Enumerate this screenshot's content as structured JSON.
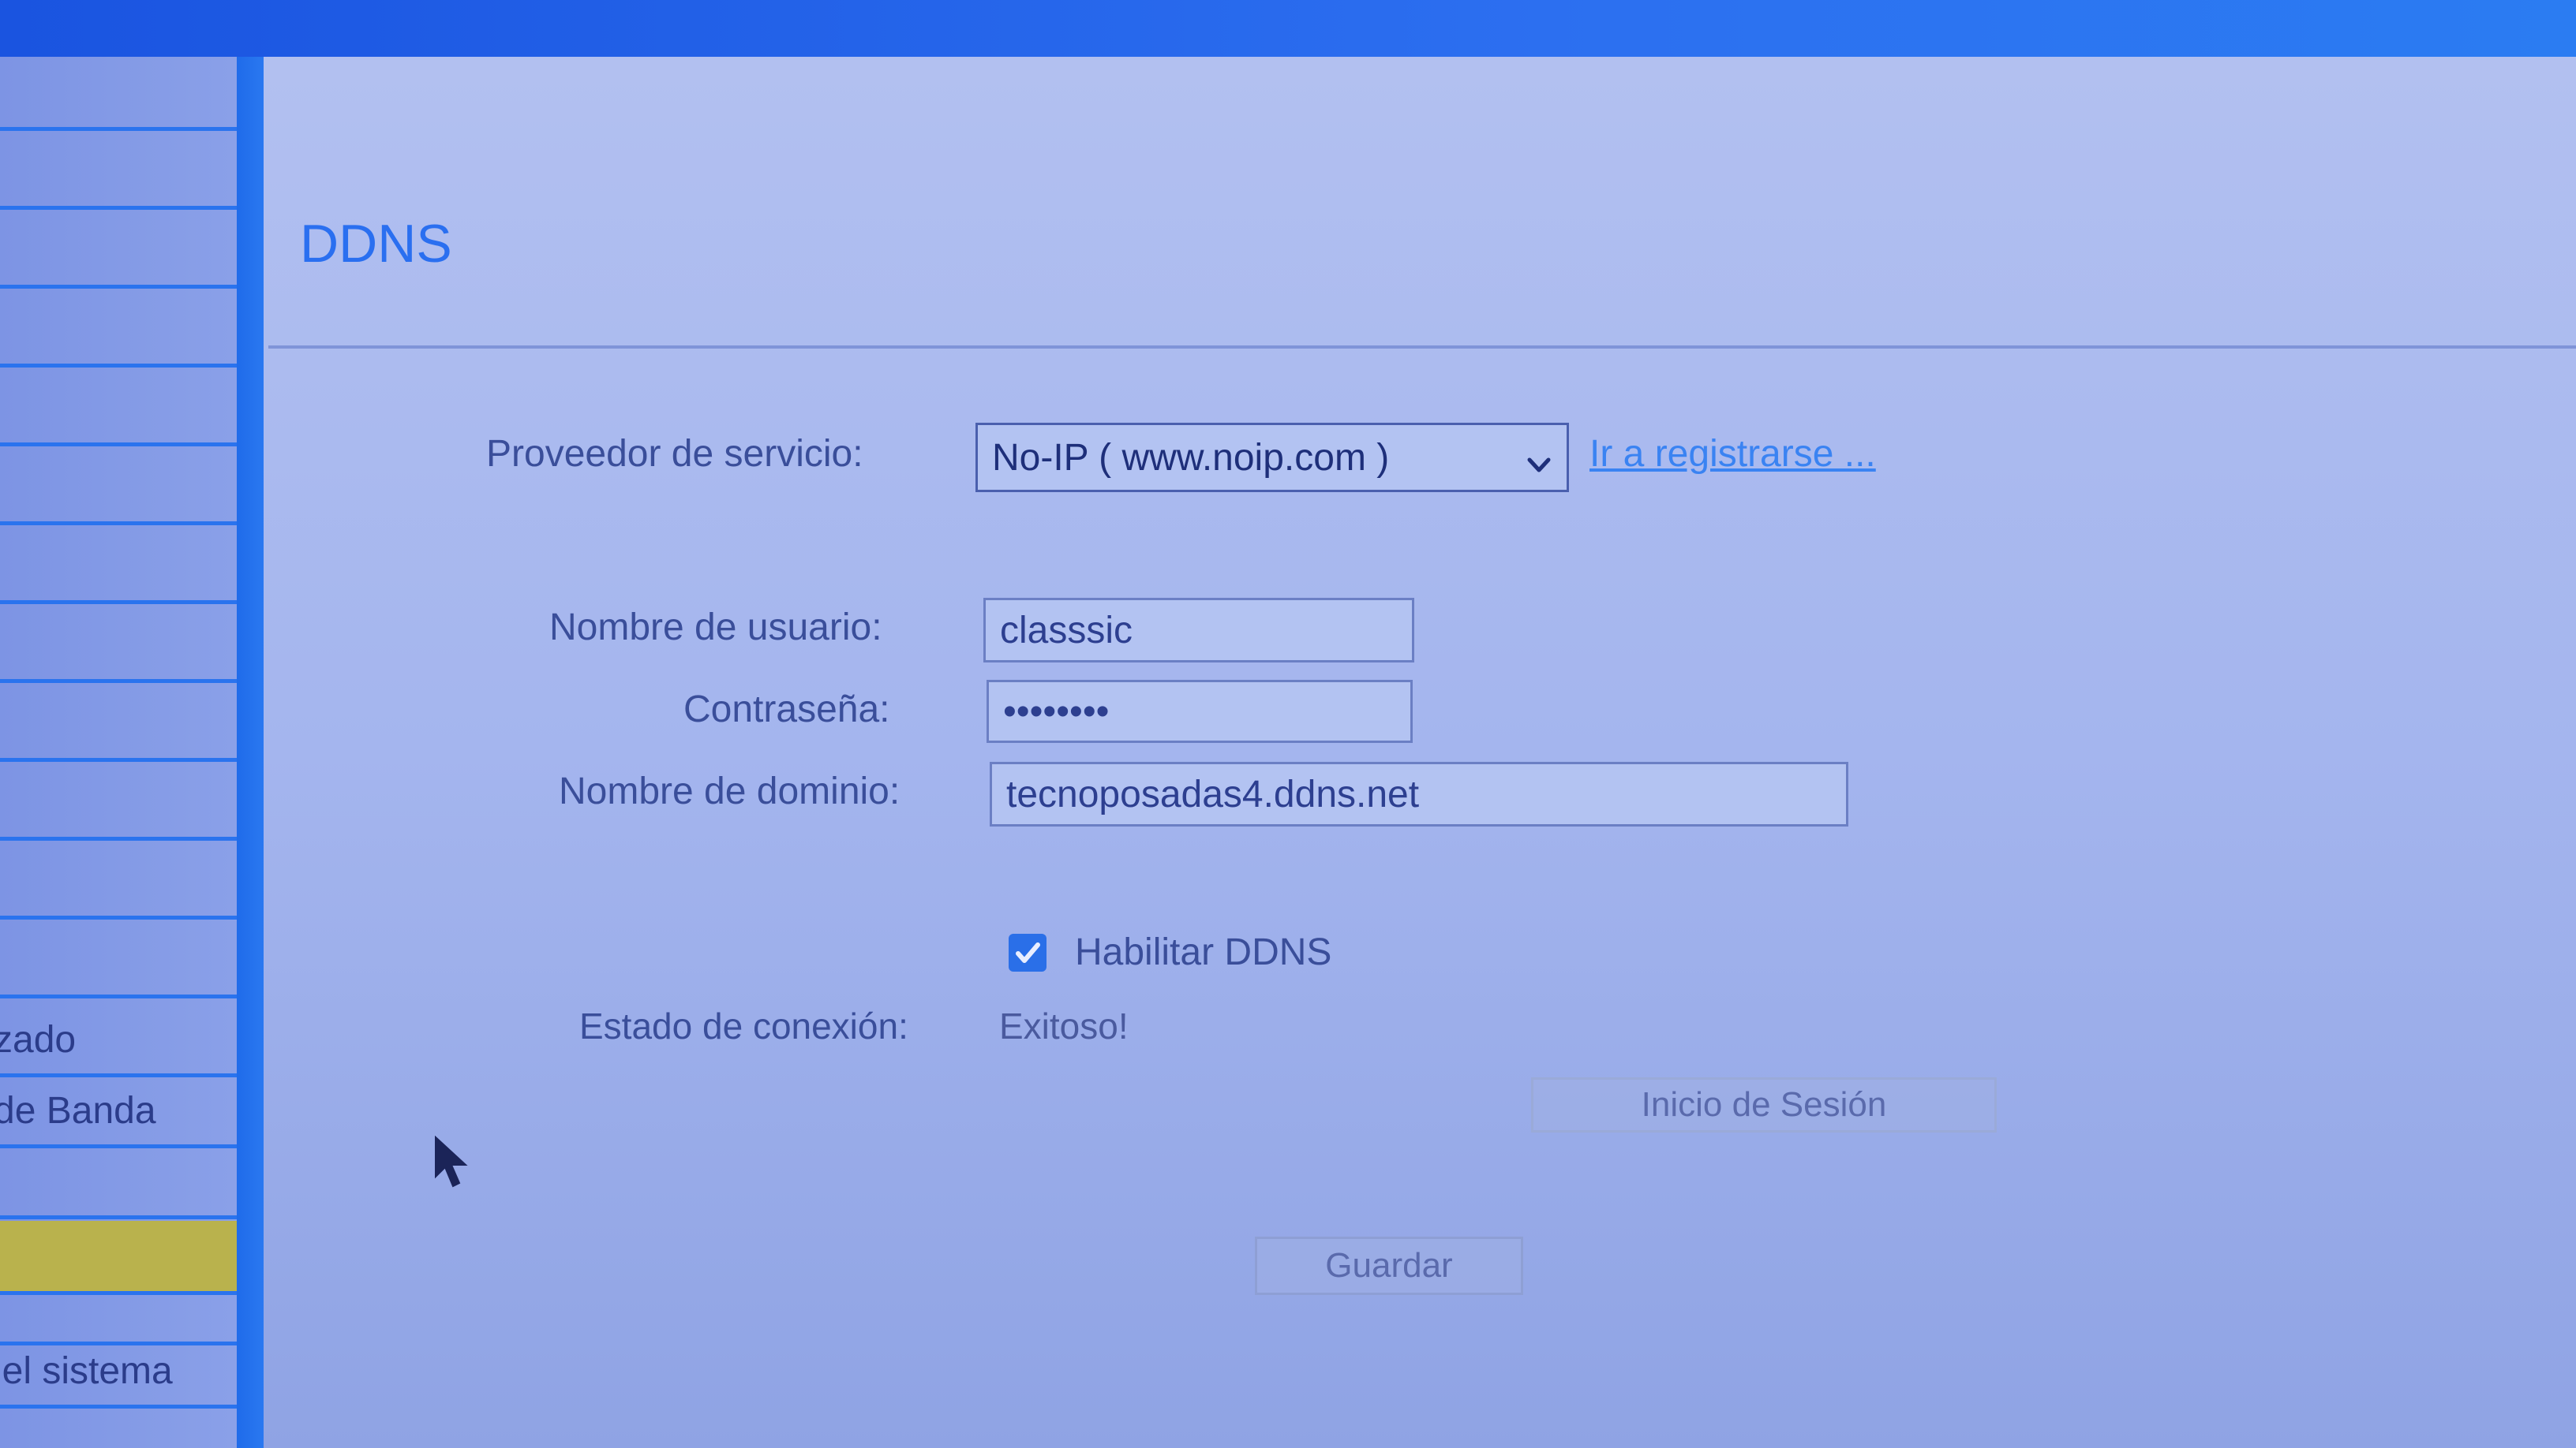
{
  "page": {
    "title": "DDNS"
  },
  "sidebar": {
    "items": [
      {
        "label": ""
      },
      {
        "label": ""
      },
      {
        "label": ""
      },
      {
        "label": ""
      },
      {
        "label": ""
      },
      {
        "label": ""
      },
      {
        "label": ""
      },
      {
        "label": ""
      },
      {
        "label": ""
      },
      {
        "label": ""
      },
      {
        "label": ""
      },
      {
        "label": ""
      },
      {
        "label": "zado"
      },
      {
        "label": "de Banda"
      },
      {
        "label": ""
      },
      {
        "label": "",
        "active": true
      },
      {
        "label": ""
      },
      {
        "label": "lel sistema"
      }
    ]
  },
  "form": {
    "provider_label": "Proveedor de servicio:",
    "provider_value": "No-IP ( www.noip.com )",
    "register_link": "Ir a registrarse ...",
    "username_label": "Nombre de usuario:",
    "username_value": "classsic",
    "password_label": "Contraseña:",
    "password_value": "••••••••",
    "domain_label": "Nombre de dominio:",
    "domain_value": "tecnoposadas4.ddns.net",
    "enable_label": "Habilitar DDNS",
    "enable_checked": true,
    "status_label": "Estado de conexión:",
    "status_value": "Exitoso!",
    "login_button": "Inicio de Sesión",
    "save_button": "Guardar"
  },
  "colors": {
    "accent": "#2a6ff0",
    "link": "#3a83f2",
    "sidebar_active": "#b9b24d"
  },
  "icons": {
    "dropdown": "chevron-down-icon",
    "checkbox": "checkmark-icon",
    "cursor": "mouse-pointer-icon"
  }
}
